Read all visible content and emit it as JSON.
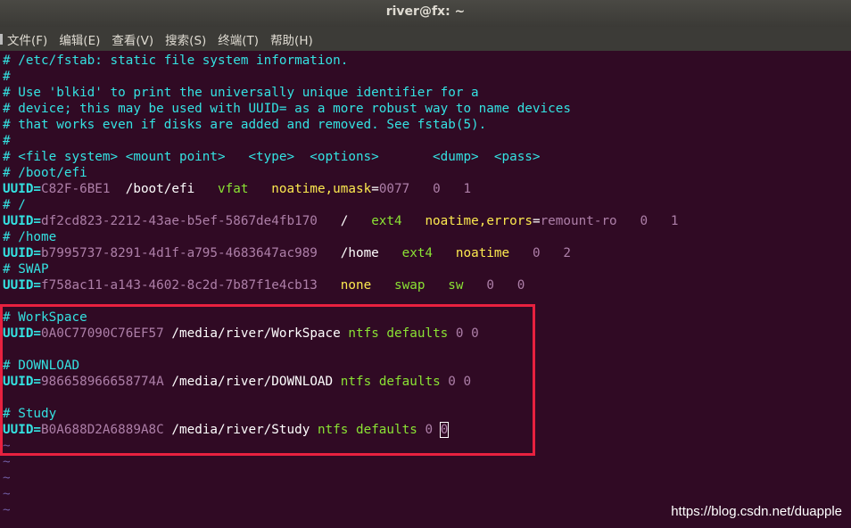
{
  "window": {
    "title": "river@fx: ~"
  },
  "menu": [
    {
      "label": "文件(F)"
    },
    {
      "label": "编辑(E)"
    },
    {
      "label": "查看(V)"
    },
    {
      "label": "搜索(S)"
    },
    {
      "label": "终端(T)"
    },
    {
      "label": "帮助(H)"
    }
  ],
  "lines": [
    {
      "segs": [
        {
          "t": "# /etc/fstab: static file system information.",
          "c": "c"
        }
      ]
    },
    {
      "segs": [
        {
          "t": "#",
          "c": "c"
        }
      ]
    },
    {
      "segs": [
        {
          "t": "# Use 'blkid' to print the universally unique identifier for a",
          "c": "c"
        }
      ]
    },
    {
      "segs": [
        {
          "t": "# device; this may be used with UUID= as a more robust way to name devices",
          "c": "c"
        }
      ]
    },
    {
      "segs": [
        {
          "t": "# that works even if disks are added and removed. See fstab(5).",
          "c": "c"
        }
      ]
    },
    {
      "segs": [
        {
          "t": "#",
          "c": "c"
        }
      ]
    },
    {
      "segs": [
        {
          "t": "# <file system> <mount point>   <type>  <options>       <dump>  <pass>",
          "c": "c"
        }
      ]
    },
    {
      "segs": [
        {
          "t": "# /boot/efi",
          "c": "c"
        }
      ]
    },
    {
      "segs": [
        {
          "t": "UUID=",
          "c": "k"
        },
        {
          "t": "C82F-6BE1",
          "c": "m"
        },
        {
          "t": "  /boot/efi   ",
          "c": "w"
        },
        {
          "t": "vfat",
          "c": "g"
        },
        {
          "t": "   ",
          "c": "w"
        },
        {
          "t": "noatime,umask",
          "c": "y"
        },
        {
          "t": "=",
          "c": "w"
        },
        {
          "t": "0077",
          "c": "m"
        },
        {
          "t": "   ",
          "c": "w"
        },
        {
          "t": "0",
          "c": "m"
        },
        {
          "t": "   ",
          "c": "w"
        },
        {
          "t": "1",
          "c": "m"
        }
      ]
    },
    {
      "segs": [
        {
          "t": "# /",
          "c": "c"
        }
      ]
    },
    {
      "segs": [
        {
          "t": "UUID=",
          "c": "k"
        },
        {
          "t": "df2cd823-2212-43ae-b5ef-5867de4fb170",
          "c": "m"
        },
        {
          "t": "   /   ",
          "c": "w"
        },
        {
          "t": "ext4",
          "c": "g"
        },
        {
          "t": "   ",
          "c": "w"
        },
        {
          "t": "noatime,errors",
          "c": "y"
        },
        {
          "t": "=",
          "c": "w"
        },
        {
          "t": "remount-ro",
          "c": "m"
        },
        {
          "t": "   ",
          "c": "w"
        },
        {
          "t": "0",
          "c": "m"
        },
        {
          "t": "   ",
          "c": "w"
        },
        {
          "t": "1",
          "c": "m"
        }
      ]
    },
    {
      "segs": [
        {
          "t": "# /home",
          "c": "c"
        }
      ]
    },
    {
      "segs": [
        {
          "t": "UUID=",
          "c": "k"
        },
        {
          "t": "b7995737-8291-4d1f-a795-4683647ac989",
          "c": "m"
        },
        {
          "t": "   /home   ",
          "c": "w"
        },
        {
          "t": "ext4",
          "c": "g"
        },
        {
          "t": "   ",
          "c": "w"
        },
        {
          "t": "noatime",
          "c": "y"
        },
        {
          "t": "   ",
          "c": "w"
        },
        {
          "t": "0",
          "c": "m"
        },
        {
          "t": "   ",
          "c": "w"
        },
        {
          "t": "2",
          "c": "m"
        }
      ]
    },
    {
      "segs": [
        {
          "t": "# SWAP",
          "c": "c"
        }
      ]
    },
    {
      "segs": [
        {
          "t": "UUID=",
          "c": "k"
        },
        {
          "t": "f758ac11-a143-4602-8c2d-7b87f1e4cb13",
          "c": "m"
        },
        {
          "t": "   ",
          "c": "w"
        },
        {
          "t": "none",
          "c": "y"
        },
        {
          "t": "   ",
          "c": "w"
        },
        {
          "t": "swap",
          "c": "g"
        },
        {
          "t": "   ",
          "c": "w"
        },
        {
          "t": "sw",
          "c": "g"
        },
        {
          "t": "   ",
          "c": "w"
        },
        {
          "t": "0",
          "c": "m"
        },
        {
          "t": "   ",
          "c": "w"
        },
        {
          "t": "0",
          "c": "m"
        }
      ]
    },
    {
      "segs": []
    },
    {
      "segs": [
        {
          "t": "# WorkSpace",
          "c": "c"
        }
      ]
    },
    {
      "segs": [
        {
          "t": "UUID=",
          "c": "k"
        },
        {
          "t": "0A0C77090C76EF57",
          "c": "m"
        },
        {
          "t": " /media/river/WorkSpace ",
          "c": "w"
        },
        {
          "t": "ntfs",
          "c": "g"
        },
        {
          "t": " ",
          "c": "w"
        },
        {
          "t": "defaults",
          "c": "g"
        },
        {
          "t": " ",
          "c": "w"
        },
        {
          "t": "0",
          "c": "m"
        },
        {
          "t": " ",
          "c": "w"
        },
        {
          "t": "0",
          "c": "m"
        }
      ]
    },
    {
      "segs": []
    },
    {
      "segs": [
        {
          "t": "# DOWNLOAD",
          "c": "c"
        }
      ]
    },
    {
      "segs": [
        {
          "t": "UUID=",
          "c": "k"
        },
        {
          "t": "986658966658774A",
          "c": "m"
        },
        {
          "t": " /media/river/DOWNLOAD ",
          "c": "w"
        },
        {
          "t": "ntfs",
          "c": "g"
        },
        {
          "t": " ",
          "c": "w"
        },
        {
          "t": "defaults",
          "c": "g"
        },
        {
          "t": " ",
          "c": "w"
        },
        {
          "t": "0",
          "c": "m"
        },
        {
          "t": " ",
          "c": "w"
        },
        {
          "t": "0",
          "c": "m"
        }
      ]
    },
    {
      "segs": []
    },
    {
      "segs": [
        {
          "t": "# Study",
          "c": "c"
        }
      ]
    },
    {
      "segs": [
        {
          "t": "UUID=",
          "c": "k"
        },
        {
          "t": "B0A688D2A6889A8C",
          "c": "m"
        },
        {
          "t": " /media/river/Study ",
          "c": "w"
        },
        {
          "t": "ntfs",
          "c": "g"
        },
        {
          "t": " ",
          "c": "w"
        },
        {
          "t": "defaults",
          "c": "g"
        },
        {
          "t": " ",
          "c": "w"
        },
        {
          "t": "0",
          "c": "m"
        },
        {
          "t": " ",
          "c": "w"
        },
        {
          "t": "0",
          "c": "m",
          "cursor": true
        }
      ]
    },
    {
      "segs": [
        {
          "t": "~",
          "c": "t"
        }
      ]
    },
    {
      "segs": [
        {
          "t": "~",
          "c": "t"
        }
      ]
    },
    {
      "segs": [
        {
          "t": "~",
          "c": "t"
        }
      ]
    },
    {
      "segs": [
        {
          "t": "~",
          "c": "t"
        }
      ]
    },
    {
      "segs": [
        {
          "t": "~",
          "c": "t"
        }
      ]
    }
  ],
  "watermark": "https://blog.csdn.net/duapple",
  "colors": {
    "background": "#300a24",
    "comment": "#34e2e2",
    "number": "#ad7fa8",
    "keyword": "#8ae234",
    "option": "#fce94f",
    "highlight_box": "#e8213f"
  }
}
